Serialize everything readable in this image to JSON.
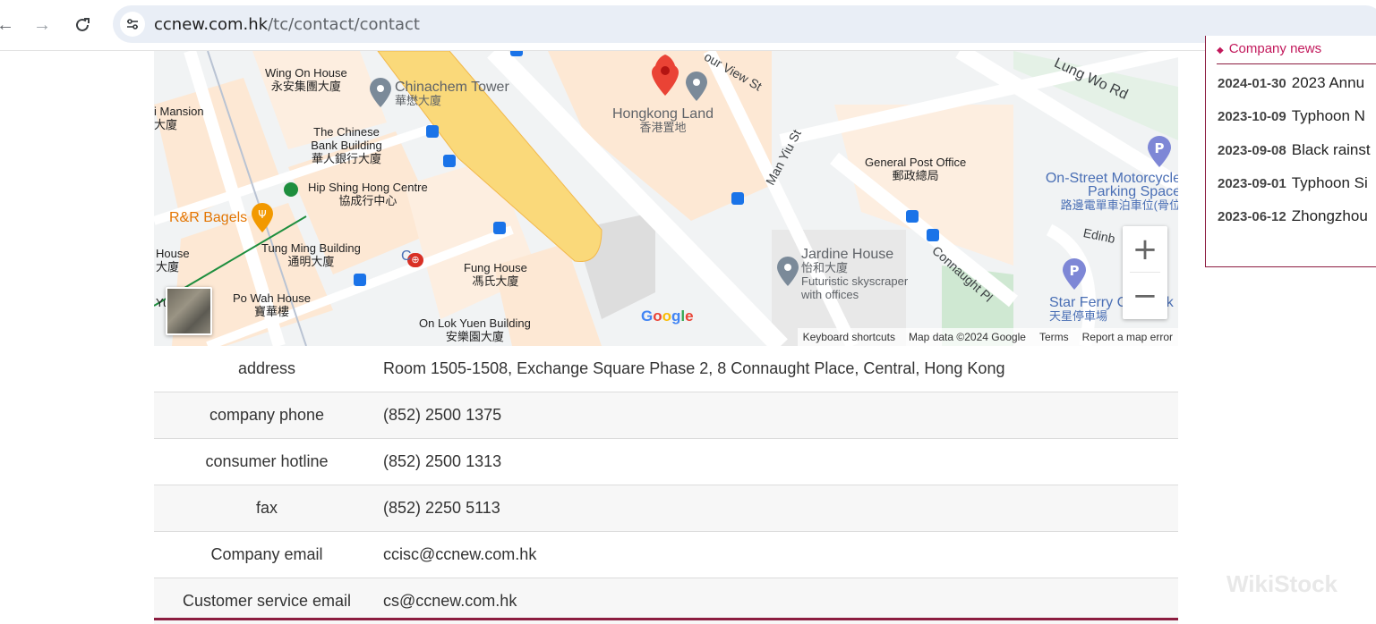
{
  "browser": {
    "url_host": "ccnew.com.hk",
    "url_path": "/tc/contact/contact"
  },
  "map": {
    "labels": {
      "wing_on_en": "Wing On House",
      "wing_on_zh": "永安集團大廈",
      "chinachem_en": "Chinachem Tower",
      "chinachem_zh": "華懋大廈",
      "hongkong_land_en": "Hongkong Land",
      "hongkong_land_zh": "香港置地",
      "mansion_en": "i Mansion",
      "mansion_zh": "大廈",
      "chinese_bank_en": "The Chinese Bank Building",
      "chinese_bank_zh": "華人銀行大廈",
      "hip_shing_en": "Hip Shing Hong Centre",
      "hip_shing_zh": "協成行中心",
      "rr_bagels": "R&R Bagels",
      "tung_ming_en": "Tung Ming Building",
      "tung_ming_zh": "通明大廈",
      "house_left_en": "House",
      "house_left_zh": "大廈",
      "po_wah_en": "Po Wah House",
      "po_wah_zh": "寶華樓",
      "fung_house_en": "Fung House",
      "fung_house_zh": "馮氏大廈",
      "on_lok_en": "On Lok Yuen Building",
      "on_lok_zh": "安樂園大廈",
      "gpo_en": "General Post Office",
      "gpo_zh": "郵政總局",
      "jardine_en": "Jardine House",
      "jardine_zh": "怡和大廈",
      "jardine_desc": "Futuristic skyscraper with offices",
      "moto_parking_en": "On-Street Motorcycle Parking Space",
      "moto_parking_zh": "路邊電單車泊車位(骨位",
      "star_ferry_en": "Star Ferry Car Park",
      "star_ferry_zh": "天星停車場",
      "road_lung_wo": "Lung Wo Rd",
      "road_harbour_view": "our View St",
      "road_man_yiu": "Man Yiu St",
      "road_connaught": "Connaught Pl",
      "road_edinburgh": "Edinb",
      "central_station": "C",
      "yu_ling": "Yu  ling"
    },
    "zoom_in": "+",
    "zoom_out": "−",
    "google_logo": "Google",
    "attribution": {
      "keyboard": "Keyboard shortcuts",
      "map_data": "Map data ©2024 Google",
      "terms": "Terms",
      "report": "Report a map error"
    }
  },
  "contact": {
    "rows": [
      {
        "key": "address",
        "value": "Room 1505-1508, Exchange Square Phase 2, 8 Connaught Place, Central, Hong Kong"
      },
      {
        "key": "company phone",
        "value": "(852) 2500 1375"
      },
      {
        "key": "consumer hotline",
        "value": "(852) 2500 1313"
      },
      {
        "key": "fax",
        "value": "(852) 2250 5113"
      },
      {
        "key": "Company email",
        "value": "ccisc@ccnew.com.hk"
      },
      {
        "key": "Customer service email",
        "value": "cs@ccnew.com.hk"
      }
    ]
  },
  "news": {
    "heading": "Company news",
    "items": [
      {
        "date": "2024-01-30",
        "title": "2023 Annu"
      },
      {
        "date": "2023-10-09",
        "title": "Typhoon N"
      },
      {
        "date": "2023-09-08",
        "title": "Black rainst"
      },
      {
        "date": "2023-09-01",
        "title": "Typhoon Si"
      },
      {
        "date": "2023-06-12",
        "title": "Zhongzhou"
      }
    ]
  },
  "watermark": "WikiStock",
  "colors": {
    "accent": "#8c1d40",
    "news_heading": "#c2185b",
    "map_pin": "#ea4335",
    "highlight_road": "#fad97a"
  }
}
